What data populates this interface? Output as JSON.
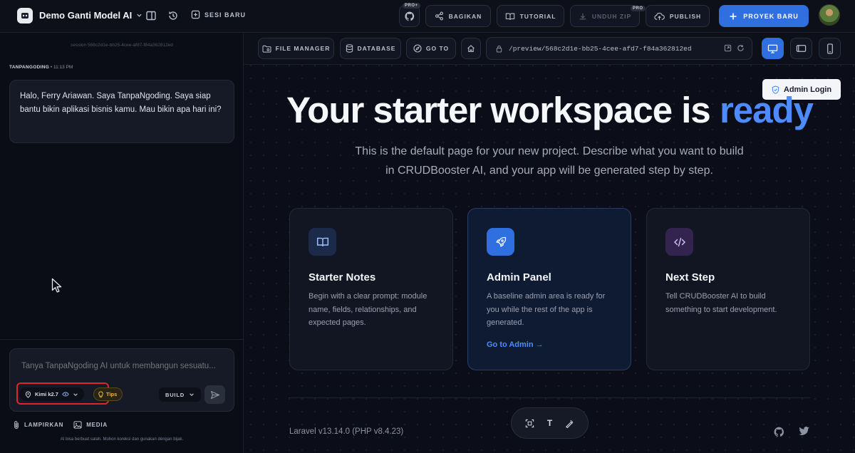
{
  "topbar": {
    "project_name": "Demo Ganti Model AI",
    "new_session": "SESI BARU",
    "github_pro_tag": "PRO+",
    "share": "BAGIKAN",
    "tutorial": "TUTORIAL",
    "download_zip": "UNDUH ZIP",
    "download_pro_tag": "PRO",
    "publish": "PUBLISH",
    "new_project": "PROYEK BARU"
  },
  "chat": {
    "session_id": "session 568c2d1e-bb25-4cee-afd7-f84a362812ed",
    "message_author": "TANPANGODING",
    "message_time": "• 11:13 PM",
    "message_text": "Halo, Ferry Ariawan. Saya TanpaNgoding. Saya siap bantu bikin aplikasi bisnis kamu. Mau bikin apa hari ini?",
    "input_placeholder": "Tanya TanpaNgoding AI untuk membangun sesuatu...",
    "model_label": "Kimi k2.7",
    "tips_label": "Tips",
    "mode_label": "BUILD",
    "attach_label": "LAMPIRKAN",
    "media_label": "MEDIA",
    "disclaimer": "AI bisa berbuat salah. Mohon koreksi dan gunakan dengan bijak."
  },
  "preview_toolbar": {
    "file_manager": "FILE MANAGER",
    "database": "DATABASE",
    "goto": "GO TO",
    "url": "/preview/568c2d1e-bb25-4cee-afd7-f84a362812ed"
  },
  "preview": {
    "admin_login": "Admin Login",
    "hero_prefix": "Your starter workspace is ",
    "hero_accent": "ready",
    "subtitle": "This is the default page for your new project. Describe what you want to build in CRUDBooster AI, and your app will be generated step by step.",
    "cards": [
      {
        "title": "Starter Notes",
        "desc": "Begin with a clear prompt: module name, fields, relationships, and expected pages.",
        "link": ""
      },
      {
        "title": "Admin Panel",
        "desc": "A baseline admin area is ready for you while the rest of the app is generated.",
        "link": "Go to Admin →"
      },
      {
        "title": "Next Step",
        "desc": "Tell CRUDBooster AI to build something to start development.",
        "link": ""
      }
    ],
    "footer": "Laravel v13.14.0 (PHP v8.4.23)",
    "float_text_tool": "T"
  },
  "colors": {
    "accent": "#4d8bff",
    "primary_button": "#2f6fe0",
    "highlight_box": "#e0242a",
    "background": "#0b0e18"
  },
  "icons": [
    "logo-icon",
    "chevron-down-icon",
    "sidebar-toggle-icon",
    "history-icon",
    "plus-square-icon",
    "github-icon",
    "share-icon",
    "book-icon",
    "download-icon",
    "cloud-upload-icon",
    "plus-icon",
    "folder-icon",
    "database-icon",
    "compass-icon",
    "home-icon",
    "lock-icon",
    "external-link-icon",
    "refresh-icon",
    "desktop-icon",
    "tablet-icon",
    "phone-icon",
    "shield-icon",
    "rocket-icon",
    "code-icon",
    "twitter-icon",
    "paperclip-icon",
    "image-icon",
    "send-icon",
    "lightbulb-icon",
    "eye-icon",
    "select-frame-icon",
    "magic-edit-icon",
    "cursor-icon"
  ]
}
